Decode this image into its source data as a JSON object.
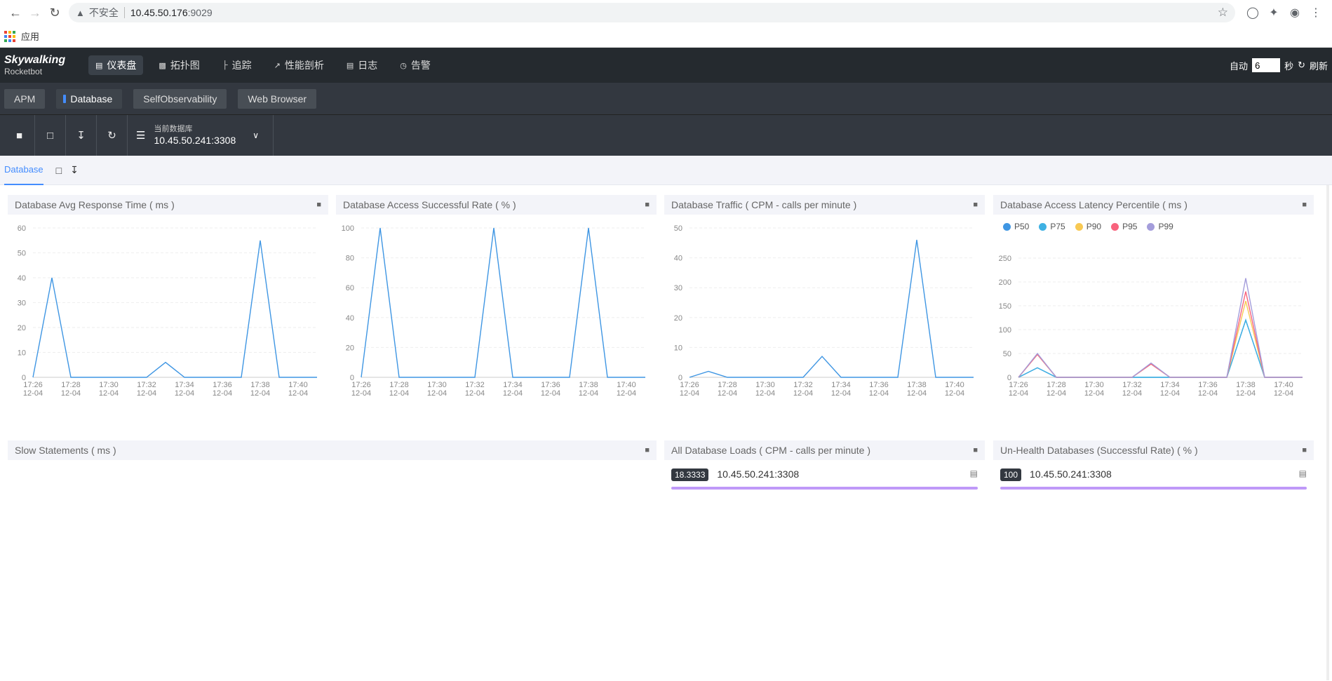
{
  "browser": {
    "insecure_label": "不安全",
    "url_host": "10.45.50.176",
    "url_port": ":9029",
    "bookmark_apps": "应用"
  },
  "header": {
    "logo_top": "Skywalking",
    "logo_bottom": "Rocketbot",
    "nav": [
      {
        "label": "仪表盘",
        "icon": "chart-icon"
      },
      {
        "label": "拓扑图",
        "icon": "topology-icon"
      },
      {
        "label": "追踪",
        "icon": "trace-icon"
      },
      {
        "label": "性能剖析",
        "icon": "profile-icon"
      },
      {
        "label": "日志",
        "icon": "log-icon"
      },
      {
        "label": "告警",
        "icon": "alarm-icon"
      }
    ],
    "auto_label": "自动",
    "interval_value": "6",
    "seconds_label": "秒",
    "refresh_label": "刷新"
  },
  "layers": [
    "APM",
    "Database",
    "SelfObservability",
    "Web Browser"
  ],
  "toolbar": {
    "current_db_label": "当前数据库",
    "current_db_value": "10.45.50.241:3308"
  },
  "dashboard_tab": "Database",
  "x_labels": [
    [
      "17:26",
      "12-04"
    ],
    [
      "17:28",
      "12-04"
    ],
    [
      "17:30",
      "12-04"
    ],
    [
      "17:32",
      "12-04"
    ],
    [
      "17:34",
      "12-04"
    ],
    [
      "17:36",
      "12-04"
    ],
    [
      "17:38",
      "12-04"
    ],
    [
      "17:40",
      "12-04"
    ]
  ],
  "colors": {
    "line": "#3f96e3",
    "p50": "#3f96e3",
    "p75": "#3fb1e3",
    "p90": "#f8c953",
    "p95": "#f8637d",
    "p99": "#a49ddb",
    "load_bar": "#bf99f8"
  },
  "chart_data": [
    {
      "type": "line",
      "title": "Database Avg Response Time ( ms )",
      "ylim": [
        0,
        60
      ],
      "yticks": [
        0,
        10,
        20,
        30,
        40,
        50,
        60
      ],
      "x": [
        "17:26",
        "17:27",
        "17:28",
        "17:29",
        "17:30",
        "17:31",
        "17:32",
        "17:33",
        "17:34",
        "17:35",
        "17:36",
        "17:37",
        "17:38",
        "17:39",
        "17:40",
        "17:41"
      ],
      "series": [
        {
          "values": [
            0,
            40,
            0,
            0,
            0,
            0,
            0,
            6,
            0,
            0,
            0,
            0,
            55,
            0,
            0,
            0
          ]
        }
      ]
    },
    {
      "type": "line",
      "title": "Database Access Successful Rate ( % )",
      "ylim": [
        0,
        100
      ],
      "yticks": [
        0,
        20,
        40,
        60,
        80,
        100
      ],
      "x": [
        "17:26",
        "17:27",
        "17:28",
        "17:29",
        "17:30",
        "17:31",
        "17:32",
        "17:33",
        "17:34",
        "17:35",
        "17:36",
        "17:37",
        "17:38",
        "17:39",
        "17:40",
        "17:41"
      ],
      "series": [
        {
          "values": [
            0,
            100,
            0,
            0,
            0,
            0,
            0,
            100,
            0,
            0,
            0,
            0,
            100,
            0,
            0,
            0
          ]
        }
      ]
    },
    {
      "type": "line",
      "title": "Database Traffic ( CPM - calls per minute )",
      "ylim": [
        0,
        50
      ],
      "yticks": [
        0,
        10,
        20,
        30,
        40,
        50
      ],
      "x": [
        "17:26",
        "17:27",
        "17:28",
        "17:29",
        "17:30",
        "17:31",
        "17:32",
        "17:33",
        "17:34",
        "17:35",
        "17:36",
        "17:37",
        "17:38",
        "17:39",
        "17:40",
        "17:41"
      ],
      "series": [
        {
          "values": [
            0,
            2,
            0,
            0,
            0,
            0,
            0,
            7,
            0,
            0,
            0,
            0,
            46,
            0,
            0,
            0
          ]
        }
      ]
    },
    {
      "type": "line",
      "title": "Database Access Latency Percentile ( ms )",
      "ylim": [
        0,
        250
      ],
      "yticks": [
        0,
        50,
        100,
        150,
        200,
        250
      ],
      "x": [
        "17:26",
        "17:27",
        "17:28",
        "17:29",
        "17:30",
        "17:31",
        "17:32",
        "17:33",
        "17:34",
        "17:35",
        "17:36",
        "17:37",
        "17:38",
        "17:39",
        "17:40",
        "17:41"
      ],
      "series": [
        {
          "name": "P50",
          "values": [
            0,
            20,
            0,
            0,
            0,
            0,
            0,
            0,
            0,
            0,
            0,
            0,
            120,
            0,
            0,
            0
          ]
        },
        {
          "name": "P75",
          "values": [
            0,
            20,
            0,
            0,
            0,
            0,
            0,
            0,
            0,
            0,
            0,
            0,
            120,
            0,
            0,
            0
          ]
        },
        {
          "name": "P90",
          "values": [
            0,
            48,
            0,
            0,
            0,
            0,
            0,
            28,
            0,
            0,
            0,
            0,
            160,
            0,
            0,
            0
          ]
        },
        {
          "name": "P95",
          "values": [
            0,
            48,
            0,
            0,
            0,
            0,
            0,
            28,
            0,
            0,
            0,
            0,
            180,
            0,
            0,
            0
          ]
        },
        {
          "name": "P99",
          "values": [
            0,
            50,
            0,
            0,
            0,
            0,
            0,
            30,
            0,
            0,
            0,
            0,
            208,
            0,
            0,
            0
          ]
        }
      ],
      "legend": "top-left"
    }
  ],
  "bottom_panels": {
    "slow": {
      "title": "Slow Statements ( ms )"
    },
    "loads": {
      "title": "All Database Loads ( CPM - calls per minute )",
      "value": "18.3333",
      "name": "10.45.50.241:3308",
      "fraction": 1.0
    },
    "unhealth": {
      "title": "Un-Health Databases (Successful Rate) ( % )",
      "value": "100",
      "name": "10.45.50.241:3308",
      "fraction": 1.0
    }
  }
}
